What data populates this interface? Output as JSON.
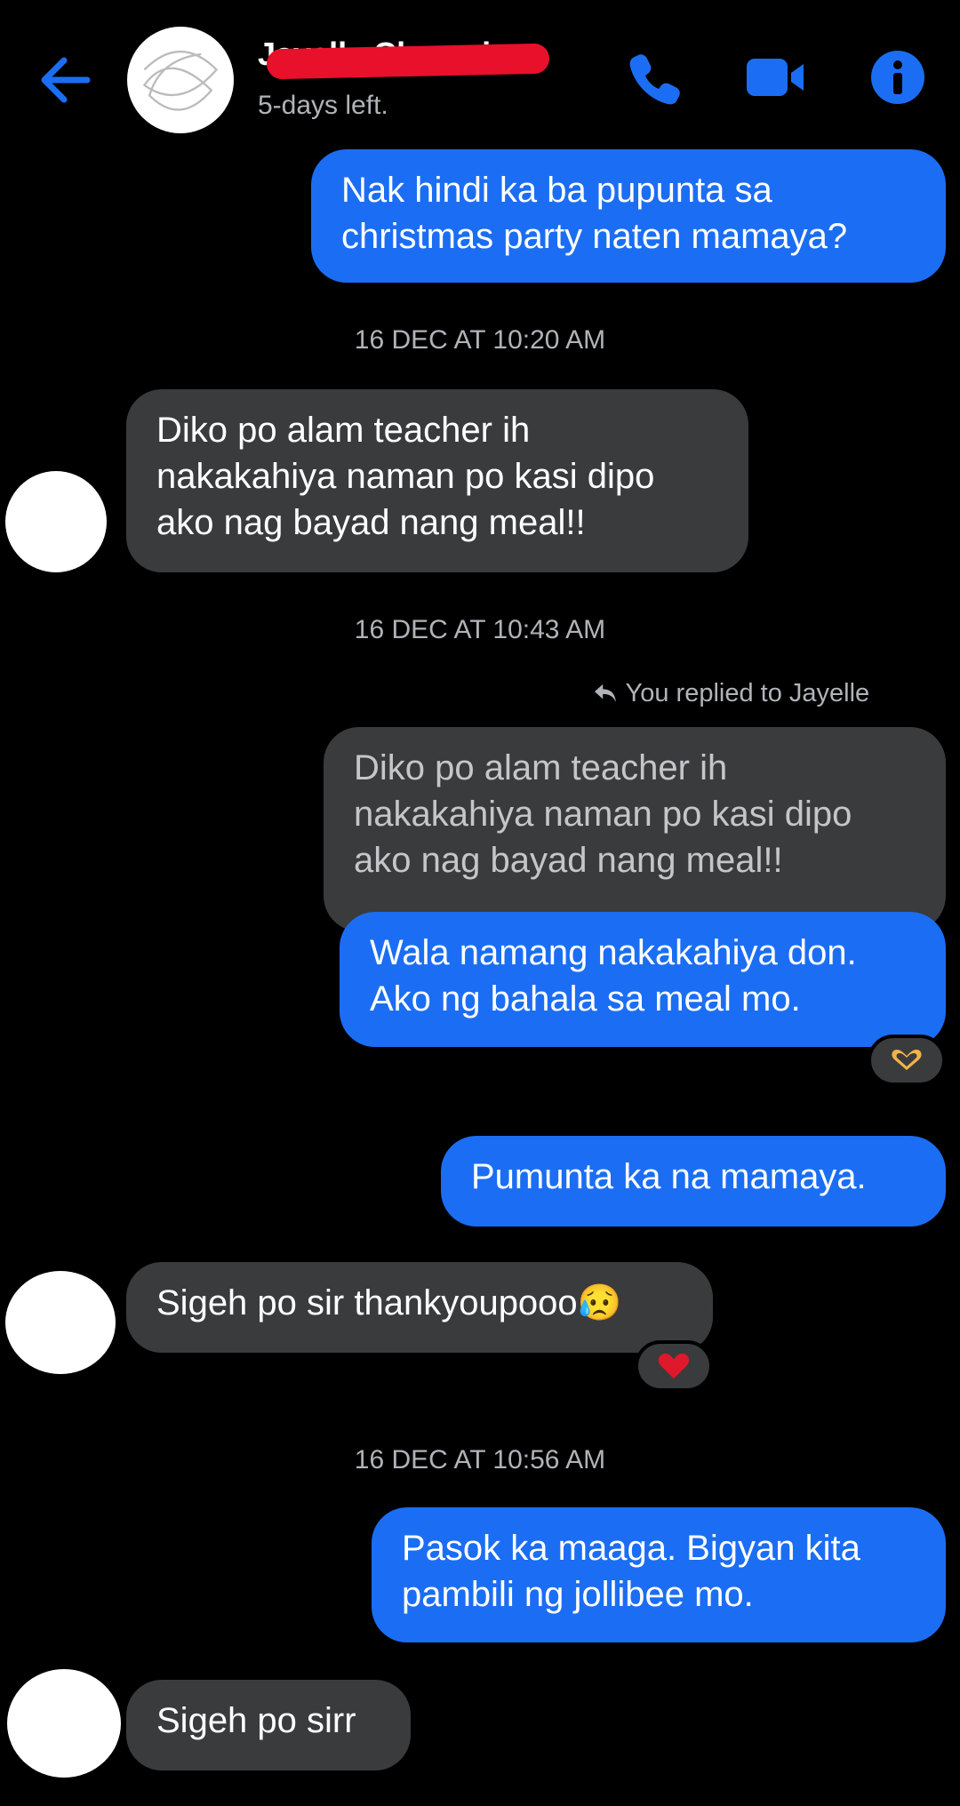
{
  "header": {
    "contact_name": "Jayelle Chumais",
    "status": "5-days left."
  },
  "messages": {
    "m1": "Nak hindi ka ba pupunta sa\nchristmas party naten mamaya?",
    "t1": "16 DEC AT 10:20 AM",
    "m2": "Diko po alam teacher ih\nnakakahiya naman po kasi dipo\nako nag bayad nang meal!!",
    "t2": "16 DEC AT 10:43 AM",
    "reply_note": "You replied to Jayelle",
    "m3_quote": "Diko po alam teacher ih\nnakakahiya naman po kasi dipo\nako nag bayad nang meal!!",
    "m3": "Wala namang nakakahiya don.\nAko ng bahala sa meal mo.",
    "m4": "Pumunta ka na mamaya.",
    "m5": "Sigeh po sir thankyoupooo😥",
    "t3": "16 DEC AT 10:56 AM",
    "m6": "Pasok ka maaga. Bigyan kita\npambili ng jollibee mo.",
    "m7": "Sigeh po sirr"
  },
  "reactions": {
    "r1": "heart-hands-reaction",
    "r2": "red-heart-reaction"
  },
  "colors": {
    "accent": "#1b6ef3",
    "incoming_bubble": "#3a3b3c",
    "background": "#000000",
    "redaction": "#e8102a"
  }
}
